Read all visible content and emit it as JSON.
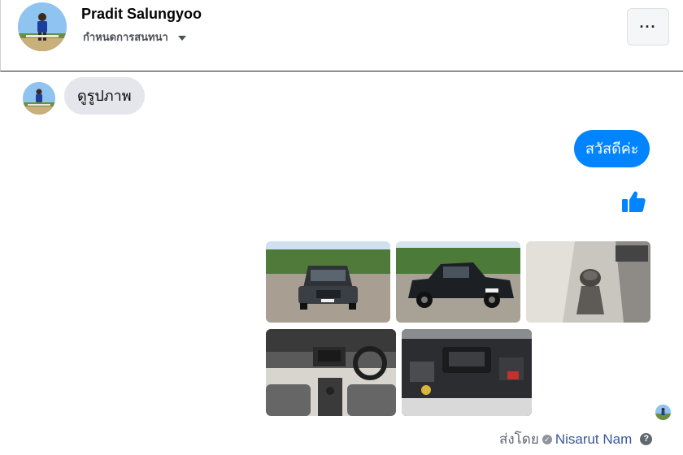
{
  "header": {
    "name": "Pradit Salungyoo",
    "subtitle": "กำหนดการสนทนา",
    "more_label": "···"
  },
  "messages": {
    "incoming_text": "ดูรูปภาพ",
    "outgoing_text": "สวัสดีค่ะ",
    "like_icon": "thumbs-up-icon"
  },
  "attachments": [
    {
      "name": "photo-pickup-front"
    },
    {
      "name": "photo-pickup-side"
    },
    {
      "name": "photo-gear-shifter"
    },
    {
      "name": "photo-dashboard-interior"
    },
    {
      "name": "photo-engine-bay"
    }
  ],
  "footer": {
    "sent_by_label": "ส่งโดย",
    "sender_name": "Nisarut Nam",
    "help_icon": "?"
  },
  "colors": {
    "accent": "#0084ff",
    "bubble_in": "#e4e6eb"
  }
}
